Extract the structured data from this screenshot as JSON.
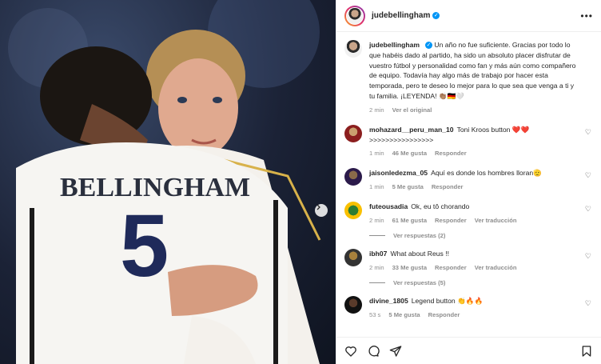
{
  "post": {
    "username": "judebellingham",
    "verified_glyph": "✓",
    "caption_user": "judebellingham",
    "caption": "Un año no fue suficiente. Gracias por todo lo que habéis dado al partido, ha sido un absoluto placer disfrutar de vuestro fútbol y personalidad como fan y más aún como compañero de equipo. Todavía hay algo más de trabajo por hacer esta temporada, pero te deseo lo mejor para lo que sea que venga a ti y tu familia. ¡LEYENDA! 👏🏽🇩🇪🤍",
    "caption_time": "2 min",
    "see_original": "Ver el original",
    "jersey_name": "BELLINGHAM",
    "jersey_number": "5"
  },
  "comments": [
    {
      "user": "mohazard__peru_man_10",
      "text": "Toni Kroos button ❤️❤️ >>>>>>>>>>>>>>>>",
      "time": "1 min",
      "likes": "46 Me gusta",
      "reply": "Responder",
      "translate": ""
    },
    {
      "user": "jaisonledezma_05",
      "text": "Aquí es donde los hombres lloran🫡",
      "time": "1 min",
      "likes": "5 Me gusta",
      "reply": "Responder",
      "translate": ""
    },
    {
      "user": "futeousadia",
      "text": "Ok, eu tô chorando",
      "time": "2 min",
      "likes": "61 Me gusta",
      "reply": "Responder",
      "translate": "Ver traducción",
      "replies": "Ver respuestas (2)"
    },
    {
      "user": "ibh07",
      "text": "What about Reus !!",
      "time": "2 min",
      "likes": "33 Me gusta",
      "reply": "Responder",
      "translate": "Ver traducción",
      "replies": "Ver respuestas (5)"
    },
    {
      "user": "divine_1805",
      "text": "Legend button 👏🔥🔥",
      "time": "53 s",
      "likes": "5 Me gusta",
      "reply": "Responder",
      "translate": ""
    }
  ],
  "icons": {
    "more": "more-options-icon",
    "like": "heart-icon",
    "comment": "comment-icon",
    "share": "share-icon",
    "save": "bookmark-icon",
    "next": "chevron-right-icon"
  },
  "colors": {
    "verified": "#0095f6",
    "muted": "#8e8e8e",
    "text": "#262626",
    "jersey_number": "#1f2a5a"
  }
}
